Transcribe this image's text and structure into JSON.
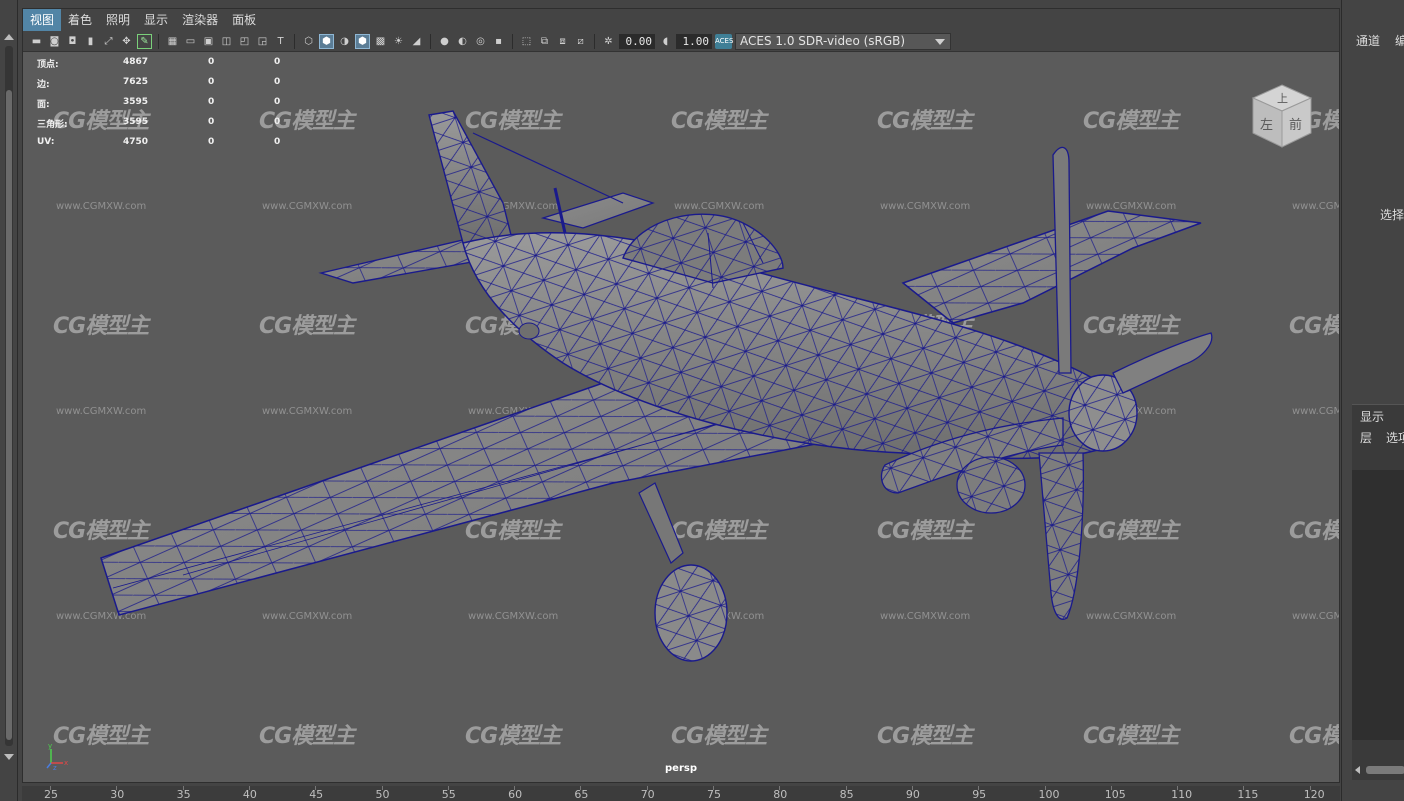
{
  "menubar": {
    "items": [
      {
        "label": "视图",
        "active": true
      },
      {
        "label": "着色",
        "active": false
      },
      {
        "label": "照明",
        "active": false
      },
      {
        "label": "显示",
        "active": false
      },
      {
        "label": "渲染器",
        "active": false
      },
      {
        "label": "面板",
        "active": false
      }
    ]
  },
  "toolbar": {
    "exposure_value": "0.00",
    "gamma_value": "1.00",
    "aces_badge": "ACES",
    "colorspace": "ACES 1.0 SDR-video (sRGB)"
  },
  "hud": {
    "rows": [
      {
        "label": "顶点:",
        "values": [
          "4867",
          "0",
          "0"
        ]
      },
      {
        "label": "边:",
        "values": [
          "7625",
          "0",
          "0"
        ]
      },
      {
        "label": "面:",
        "values": [
          "3595",
          "0",
          "0"
        ]
      },
      {
        "label": "三角形:",
        "values": [
          "3595",
          "0",
          "0"
        ]
      },
      {
        "label": "UV:",
        "values": [
          "4750",
          "0",
          "0"
        ]
      }
    ]
  },
  "viewport": {
    "camera": "persp",
    "watermark": "CG模型主",
    "watermark_url": "www.CGMXW.com"
  },
  "viewcube": {
    "top": "上",
    "left": "左",
    "front": "前"
  },
  "axis": {
    "y": "y",
    "x": "x",
    "z": "z"
  },
  "right_panel": {
    "channels": "通道",
    "edit_partial": "编",
    "select_partial": "选择",
    "display": "显示",
    "layers": "层",
    "options_partial": "选项"
  },
  "ruler": {
    "ticks": [
      "25",
      "30",
      "35",
      "40",
      "45",
      "50",
      "55",
      "60",
      "65",
      "70",
      "75",
      "80",
      "85",
      "90",
      "95",
      "100",
      "105",
      "110",
      "115",
      "120"
    ]
  },
  "colors": {
    "menu_active": "#5285a6",
    "wireframe": "#1a1a8c",
    "viewport_bg": "#5b5b5b"
  }
}
